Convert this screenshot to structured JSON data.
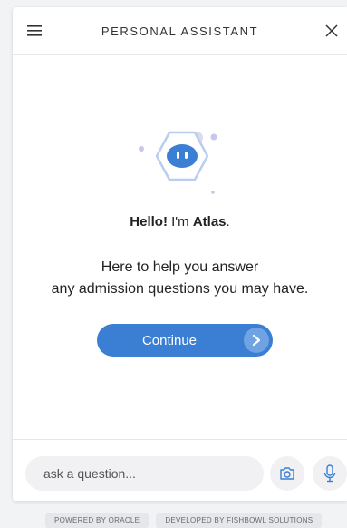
{
  "header": {
    "title": "PERSONAL ASSISTANT",
    "menu_icon": "hamburger-menu-icon",
    "close_icon": "close-icon"
  },
  "greeting": {
    "hello": "Hello!",
    "im": " I'm ",
    "name": "Atlas",
    "period": "."
  },
  "tagline": {
    "line1": "Here to help you answer",
    "line2": "any admission questions you may have."
  },
  "continue_button": {
    "label": "Continue"
  },
  "input": {
    "placeholder": "ask a question..."
  },
  "credits": {
    "powered": "POWERED BY ORACLE",
    "developed": "DEVELOPED BY FISHBOWL SOLUTIONS"
  },
  "colors": {
    "accent": "#3a7fd3",
    "accent_light": "#6fa3e2",
    "avatar_border": "#b9cdee",
    "dots": "#c5c8e6"
  }
}
